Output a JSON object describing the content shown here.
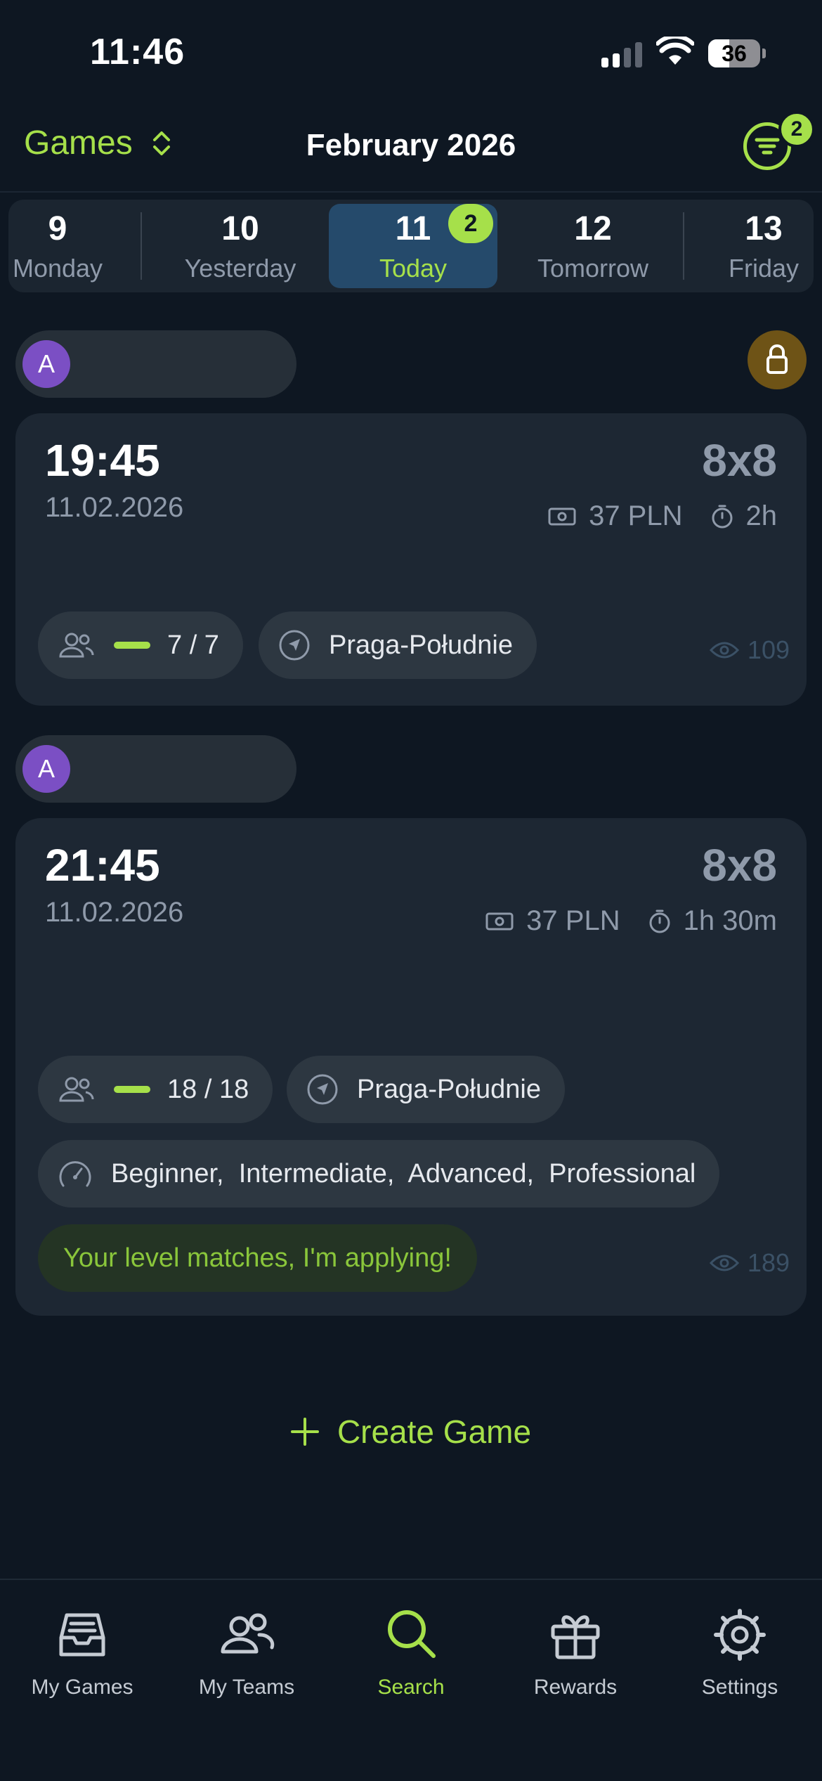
{
  "status_bar": {
    "time": "11:46",
    "battery": "36"
  },
  "header": {
    "section_title": "Games",
    "month": "February 2026",
    "filter_count": "2"
  },
  "date_strip": [
    {
      "num": "9",
      "label": "Monday"
    },
    {
      "num": "10",
      "label": "Yesterday"
    },
    {
      "num": "11",
      "label": "Today",
      "badge": "2",
      "active": true
    },
    {
      "num": "12",
      "label": "Tomorrow"
    },
    {
      "num": "13",
      "label": "Friday"
    }
  ],
  "games": [
    {
      "organizer_initial": "A",
      "locked": true,
      "time": "19:45",
      "date": "11.02.2026",
      "format": "8x8",
      "price": "37 PLN",
      "duration": "2h",
      "players": "7 / 7",
      "district": "Praga-Południe",
      "views": "109"
    },
    {
      "organizer_initial": "A",
      "time": "21:45",
      "date": "11.02.2026",
      "format": "8x8",
      "price": "37 PLN",
      "duration": "1h 30m",
      "players": "18 / 18",
      "district": "Praga-Południe",
      "levels": "Beginner,  Intermediate,  Advanced,  Professional",
      "apply_label": "Your level matches, I'm applying!",
      "views": "189"
    }
  ],
  "create_game_label": "Create Game",
  "tabbar": [
    {
      "label": "My Games",
      "icon": "inbox-icon"
    },
    {
      "label": "My Teams",
      "icon": "users-icon"
    },
    {
      "label": "Search",
      "icon": "search-icon",
      "active": true
    },
    {
      "label": "Rewards",
      "icon": "gift-icon"
    },
    {
      "label": "Settings",
      "icon": "gear-icon"
    }
  ],
  "colors": {
    "accent": "#a6e04a",
    "background": "#0e1722",
    "card": "#1d2733",
    "muted": "#8f9aaa"
  }
}
